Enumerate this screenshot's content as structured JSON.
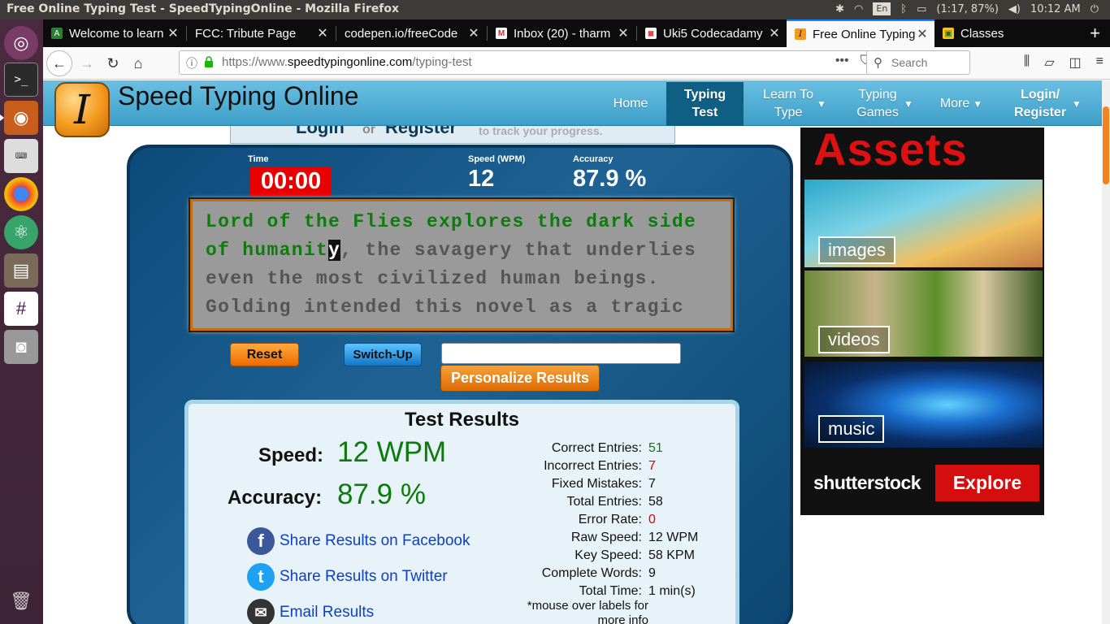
{
  "system": {
    "window_title": "Free Online Typing Test - SpeedTypingOnline - Mozilla Firefox",
    "keyboard_layout": "En",
    "battery": "(1:17, 87%)",
    "clock": "10:12 AM"
  },
  "launcher": {
    "items": [
      "ubuntu-dash",
      "terminal",
      "firefox",
      "keyboard-app",
      "chrome",
      "atom",
      "files",
      "slack",
      "screenshot",
      "trash"
    ]
  },
  "browser": {
    "tabs": [
      {
        "label": "Welcome to learn",
        "favicon_color": "#2e7d32",
        "favicon_text": "A"
      },
      {
        "label": "FCC: Tribute Page",
        "favicon_color": "#0c0c0d",
        "favicon_text": ""
      },
      {
        "label": "codepen.io/freeCode",
        "favicon_color": "#0c0c0d",
        "favicon_text": ""
      },
      {
        "label": "Inbox (20) - tharm",
        "favicon_color": "#d93025",
        "favicon_text": "M"
      },
      {
        "label": "Uki5 Codecadamy",
        "favicon_color": "#e24a4a",
        "favicon_text": "◼"
      },
      {
        "label": "Free Online Typing",
        "favicon_color": "#f39a1e",
        "favicon_text": "I"
      },
      {
        "label": "Classes",
        "favicon_color": "#f5c518",
        "favicon_text": "▣"
      }
    ],
    "active_tab_index": 5,
    "url_prefix": "https://www.",
    "url_domain": "speedtypingonline.com",
    "url_path": "/typing-test",
    "search_placeholder": "Search"
  },
  "site": {
    "name": "Speed Typing Online",
    "logo_letter": "I",
    "nav": [
      {
        "label": "Home",
        "active": false
      },
      {
        "label": "Typing Test",
        "active": true
      },
      {
        "label": "Learn To Type",
        "active": false
      },
      {
        "label": "Typing Games",
        "active": false
      },
      {
        "label": "More",
        "active": false
      },
      {
        "label": "Login/ Register",
        "active": false
      }
    ],
    "login_strip": {
      "login": "Login",
      "or": "or",
      "register": "Register",
      "rest": "to track your progress."
    }
  },
  "test": {
    "time_label": "Time",
    "time_value": "00:00",
    "speed_label": "Speed (WPM)",
    "speed_value": "12",
    "accuracy_label": "Accuracy",
    "accuracy_value": "87.9 %",
    "typed_text": "Lord of the Flies explores the dark side of humanit",
    "cursor_char": "y",
    "remaining_text": ", the savagery that underlies even the most civilized human beings. Golding intended this novel as a tragic",
    "reset_label": "Reset",
    "switch_label": "Switch-Up",
    "input_value": "",
    "personalize_label": "Personalize Results"
  },
  "results": {
    "title": "Test Results",
    "speed_label": "Speed:",
    "speed_value": "12 WPM",
    "accuracy_label": "Accuracy:",
    "accuracy_value": "87.9 %",
    "share_facebook": "Share Results on Facebook",
    "share_twitter": "Share Results on Twitter",
    "email": "Email Results",
    "stats": [
      {
        "label": "Correct Entries:",
        "value": "51",
        "color": "green"
      },
      {
        "label": "Incorrect Entries:",
        "value": "7",
        "color": "red"
      },
      {
        "label": "Fixed Mistakes:",
        "value": "7",
        "color": ""
      },
      {
        "label": "Total Entries:",
        "value": "58",
        "color": ""
      },
      {
        "label": "Error Rate:",
        "value": "0",
        "color": "red"
      },
      {
        "label": "Raw Speed:",
        "value": "12 WPM",
        "color": ""
      },
      {
        "label": "Key Speed:",
        "value": "58 KPM",
        "color": ""
      },
      {
        "label": "Complete Words:",
        "value": "9",
        "color": ""
      },
      {
        "label": "Total Time:",
        "value": "1 min(s)",
        "color": ""
      }
    ],
    "note": "*mouse over labels for more info"
  },
  "ad": {
    "title": "Assets",
    "tags": [
      "images",
      "videos",
      "music"
    ],
    "brand": "shutterstock",
    "cta": "Explore"
  }
}
